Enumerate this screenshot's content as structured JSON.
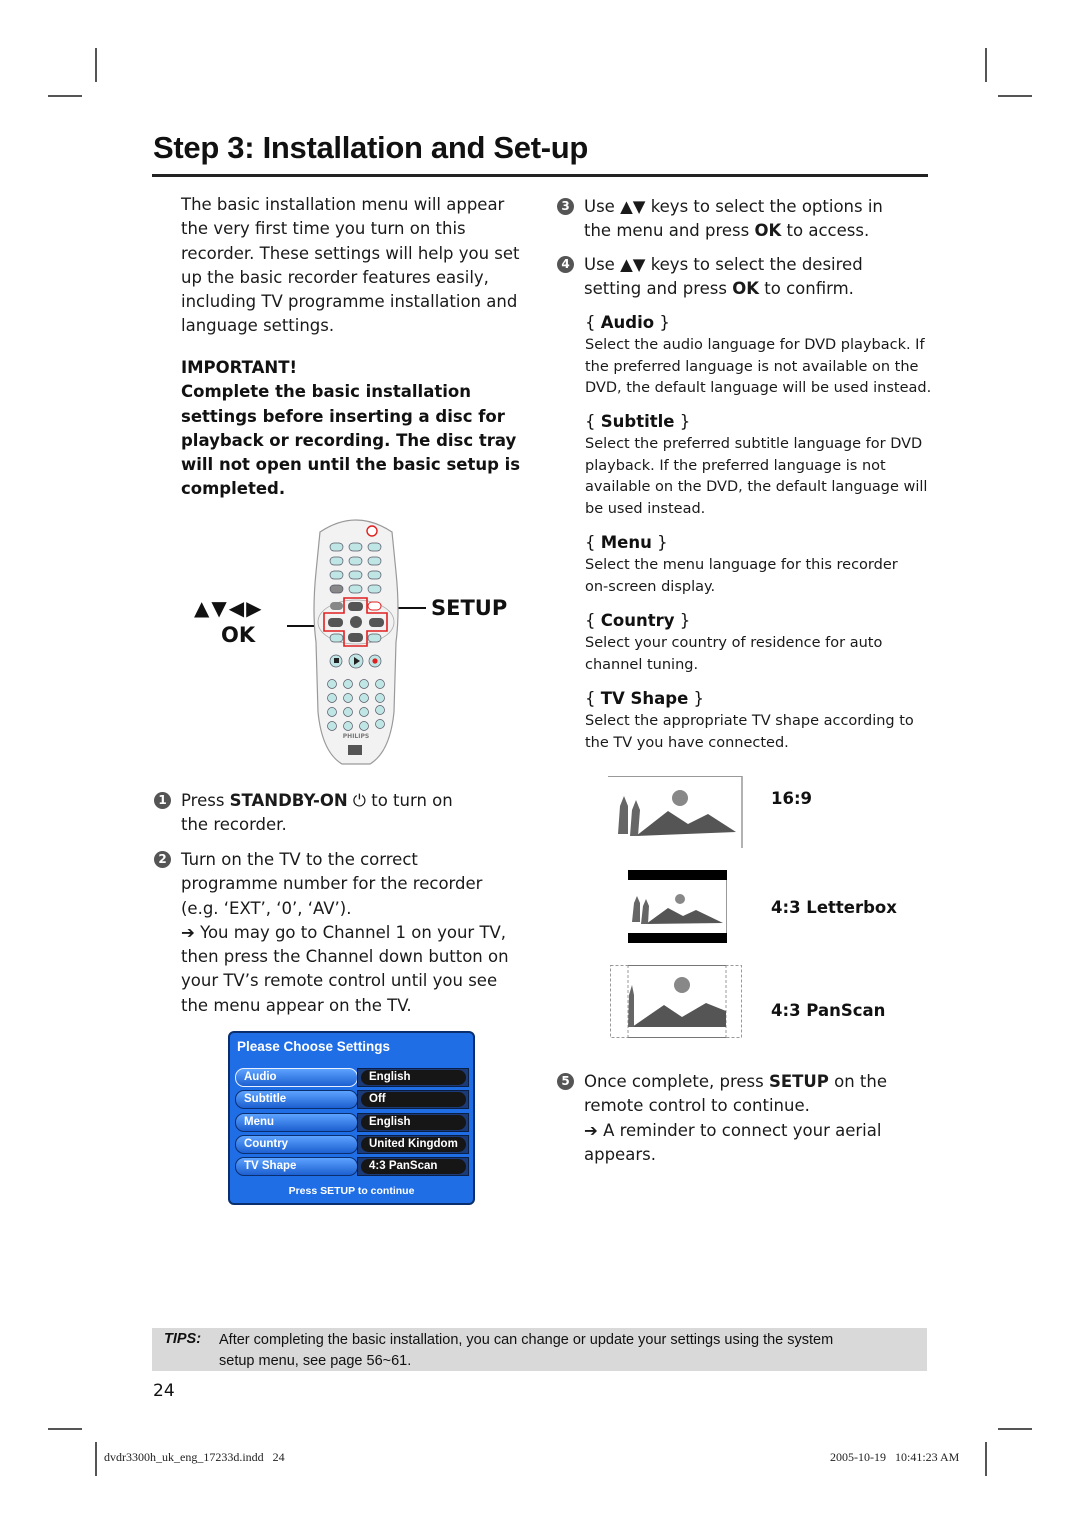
{
  "page": {
    "title": "Step 3: Installation and Set-up",
    "page_number": "24"
  },
  "intro": {
    "lines": [
      "The basic installation menu will appear",
      "the very first time you turn on this",
      "recorder. These settings will help you set",
      "up the basic recorder features easily,",
      "including TV programme installation and",
      "language settings."
    ]
  },
  "important": {
    "heading": "IMPORTANT!",
    "lines": [
      "Complete the basic installation",
      "settings before inserting a disc for",
      "playback or recording. The disc tray",
      "will not open until the basic setup is",
      "completed."
    ]
  },
  "remote": {
    "arrows_label": "▲▼◀▶",
    "ok_label": "OK",
    "setup_label": "SETUP",
    "brand": "PHILIPS",
    "accent_color": "#e02020"
  },
  "steps": [
    {
      "num": "1",
      "pre": "Press ",
      "bold": "STANDBY-ON",
      "post": " ⏻ to turn on",
      "line2": "the recorder."
    },
    {
      "num": "2",
      "lines": [
        "Turn on the TV to the correct",
        "programme number for the recorder",
        "(e.g. ‘EXT’, ‘0’, ‘AV’)."
      ],
      "note_lines": [
        "➔ You may go to Channel 1 on your TV,",
        "then press the Channel down button on",
        "your TV’s remote control until you see",
        "the menu appear on the TV."
      ]
    },
    {
      "num": "3",
      "l1a": "Use ▲▼ keys to select the options in",
      "l2a": "the menu and press ",
      "l2b": "OK",
      "l2c": " to access."
    },
    {
      "num": "4",
      "l1a": "Use ▲▼ keys to select the desired",
      "l2a": "setting and press ",
      "l2b": "OK",
      "l2c": " to confirm."
    },
    {
      "num": "5",
      "l1a": "Once complete, press ",
      "l1b": "SETUP",
      "l1c": " on the",
      "l2": "remote control to continue.",
      "note_lines": [
        "➔ A reminder to connect your aerial",
        "appears."
      ]
    }
  ],
  "options": [
    {
      "name": "Audio",
      "desc": [
        "Select the audio language for DVD playback. If",
        "the preferred language is not available on the",
        "DVD, the default language will be used instead."
      ]
    },
    {
      "name": "Subtitle",
      "desc": [
        "Select the preferred subtitle language for DVD",
        "playback. If the preferred language is not",
        "available on the DVD, the default language will",
        "be used instead."
      ]
    },
    {
      "name": "Menu",
      "desc": [
        "Select the menu language for this recorder",
        "on-screen display."
      ]
    },
    {
      "name": "Country",
      "desc": [
        "Select your country of residence for auto",
        "channel tuning."
      ]
    },
    {
      "name": "TV Shape",
      "desc": [
        "Select the appropriate TV shape according to",
        "the TV you have connected."
      ]
    }
  ],
  "tv_shapes": [
    "16:9",
    "4:3 Letterbox",
    "4:3 PanScan"
  ],
  "osd": {
    "title": "Please Choose Settings",
    "rows": [
      {
        "label": "Audio",
        "value": "English"
      },
      {
        "label": "Subtitle",
        "value": "Off"
      },
      {
        "label": "Menu",
        "value": "English"
      },
      {
        "label": "Country",
        "value": "United Kingdom"
      },
      {
        "label": "TV Shape",
        "value": "4:3 PanScan"
      }
    ],
    "footer": "Press SETUP to continue",
    "bg_color": "#1f6ee6"
  },
  "tips": {
    "label": "TIPS:",
    "lines": [
      "After completing the basic installation, you can change or update your settings using the system",
      "setup menu, see page 56~61."
    ]
  },
  "footer": {
    "file": "dvdr3300h_uk_eng_17233d.indd   24",
    "timestamp": "2005-10-19   10:41:23 AM"
  }
}
